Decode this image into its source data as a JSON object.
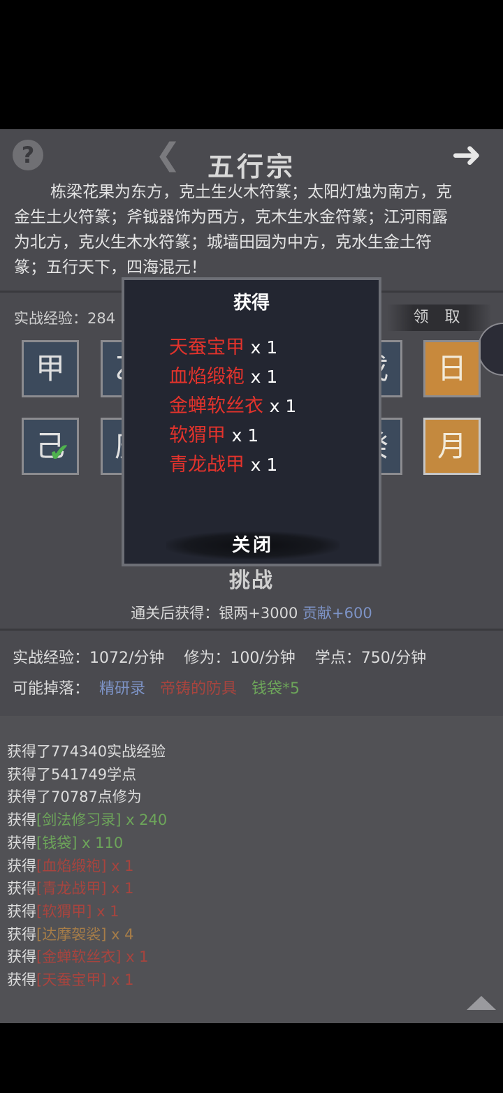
{
  "header": {
    "help_icon": "question-mark-icon",
    "prev_icon": "chevron-left-icon",
    "title": "五行宗",
    "next_icon": "arrow-right-icon"
  },
  "description": "栋梁花果为东方，克土生火木符篆；太阳灯烛为南方，克金生土火符篆；斧钺器饰为西方，克木生水金符篆；江河雨露为北方，克火生木水符篆；城墙田园为中方，克水生金土符篆；五行天下，四海混元！",
  "exp_top": "实战经验：284",
  "claim_label": "领 取",
  "tiles": {
    "row1_left": "甲",
    "row1_right": "日",
    "row2_left": "己",
    "row2_right": "月",
    "row1_partial_a": "乙",
    "row1_partial_b": "戊",
    "row2_partial_a": "庚",
    "row2_partial_b": "癸"
  },
  "challenge_label": "挑战",
  "reward": {
    "prefix": "通关后获得：银两+3000",
    "contribution": "贡献+600"
  },
  "stats": {
    "exp": "实战经验：1072/分钟",
    "cultivation": "修为：100/分钟",
    "points": "学点：750/分钟"
  },
  "drops": {
    "label": "可能掉落：",
    "item1": "精研录",
    "item2": "帝铸的防具",
    "item3": "钱袋*5"
  },
  "log": [
    {
      "prefix": "获得了774340实战经验"
    },
    {
      "prefix": "获得了541749学点"
    },
    {
      "prefix": "获得了70787点修为"
    },
    {
      "prefix": "获得",
      "item": "[剑法修习录]",
      "qty": " x 240",
      "color": "#6da55a"
    },
    {
      "prefix": "获得",
      "item": "[钱袋]",
      "qty": " x 110",
      "color": "#6da55a"
    },
    {
      "prefix": "获得",
      "item": "[血焰缎袍]",
      "qty": " x 1",
      "color": "#a8443e"
    },
    {
      "prefix": "获得",
      "item": "[青龙战甲]",
      "qty": " x 1",
      "color": "#a8443e"
    },
    {
      "prefix": "获得",
      "item": "[软猬甲]",
      "qty": " x 1",
      "color": "#a8443e"
    },
    {
      "prefix": "获得",
      "item": "[达摩袈裟]",
      "qty": " x 4",
      "color": "#a77d48"
    },
    {
      "prefix": "获得",
      "item": "[金蝉软丝衣]",
      "qty": " x 1",
      "color": "#a8443e"
    },
    {
      "prefix": "获得",
      "item": "[天蚕宝甲]",
      "qty": " x 1",
      "color": "#a8443e"
    }
  ],
  "modal": {
    "title": "获得",
    "items": [
      {
        "name": "天蚕宝甲",
        "qty": "x 1"
      },
      {
        "name": "血焰缎袍",
        "qty": "x 1"
      },
      {
        "name": "金蝉软丝衣",
        "qty": "x 1"
      },
      {
        "name": "软猬甲",
        "qty": "x 1"
      },
      {
        "name": "青龙战甲",
        "qty": "x 1"
      }
    ],
    "close_label": "关闭"
  },
  "colors": {
    "modal_item": "#e2332c",
    "drop_blue": "#7d93c6",
    "drop_red": "#a8443e",
    "drop_green": "#6da55a"
  }
}
